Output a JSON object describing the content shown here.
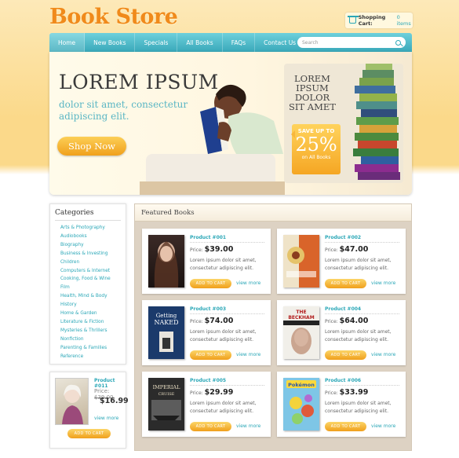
{
  "header": {
    "logo": "Book Store",
    "cart_label": "Shopping Cart:",
    "cart_count": "0 items"
  },
  "nav": {
    "items": [
      "Home",
      "New Books",
      "Specials",
      "All Books",
      "FAQs",
      "Contact Us"
    ],
    "search_placeholder": "Search"
  },
  "banner": {
    "title": "LOREM IPSUM",
    "subtitle": "dolor sit amet, consectetur adipiscing elit.",
    "cta": "Shop Now",
    "promo_text": "LOREM IPSUM DOLOR SIT AMET",
    "save_label": "SAVE UP TO",
    "save_value": "25%",
    "save_note": "on All Books"
  },
  "sidebar": {
    "title": "Categories",
    "categories": [
      "Arts & Photography",
      "Audiobooks",
      "Biography",
      "Business & Investing",
      "Children",
      "Computers & Internet",
      "Cooking, Food & Wine",
      "Film",
      "Health, Mind & Body",
      "History",
      "Home & Garden",
      "Literature & Fiction",
      "Mysteries & Thrillers",
      "Nonfiction",
      "Parenting & Families",
      "Reference"
    ]
  },
  "mini_product": {
    "name": "Product #011",
    "price_label": "Price:",
    "old_price": "$39.00",
    "new_price": "$16.99",
    "view_more": "view more",
    "add_to_cart": "ADD TO CART"
  },
  "featured": {
    "title": "Featured Books",
    "price_label": "Price:",
    "description": "Lorem ipsum dolor sit amet, consectetur adipiscing elit.",
    "add_to_cart": "ADD TO CART",
    "view_more": "view more",
    "products": [
      {
        "name": "Product #001",
        "price": "$39.00"
      },
      {
        "name": "Product #002",
        "price": "$47.00"
      },
      {
        "name": "Product #003",
        "price": "$74.00"
      },
      {
        "name": "Product #004",
        "price": "$64.00"
      },
      {
        "name": "Product #005",
        "price": "$29.99"
      },
      {
        "name": "Product #006",
        "price": "$33.99"
      }
    ]
  },
  "colors": {
    "accent": "#2aa7b7",
    "logo": "#f08a1b",
    "button": "#f0a01c"
  }
}
